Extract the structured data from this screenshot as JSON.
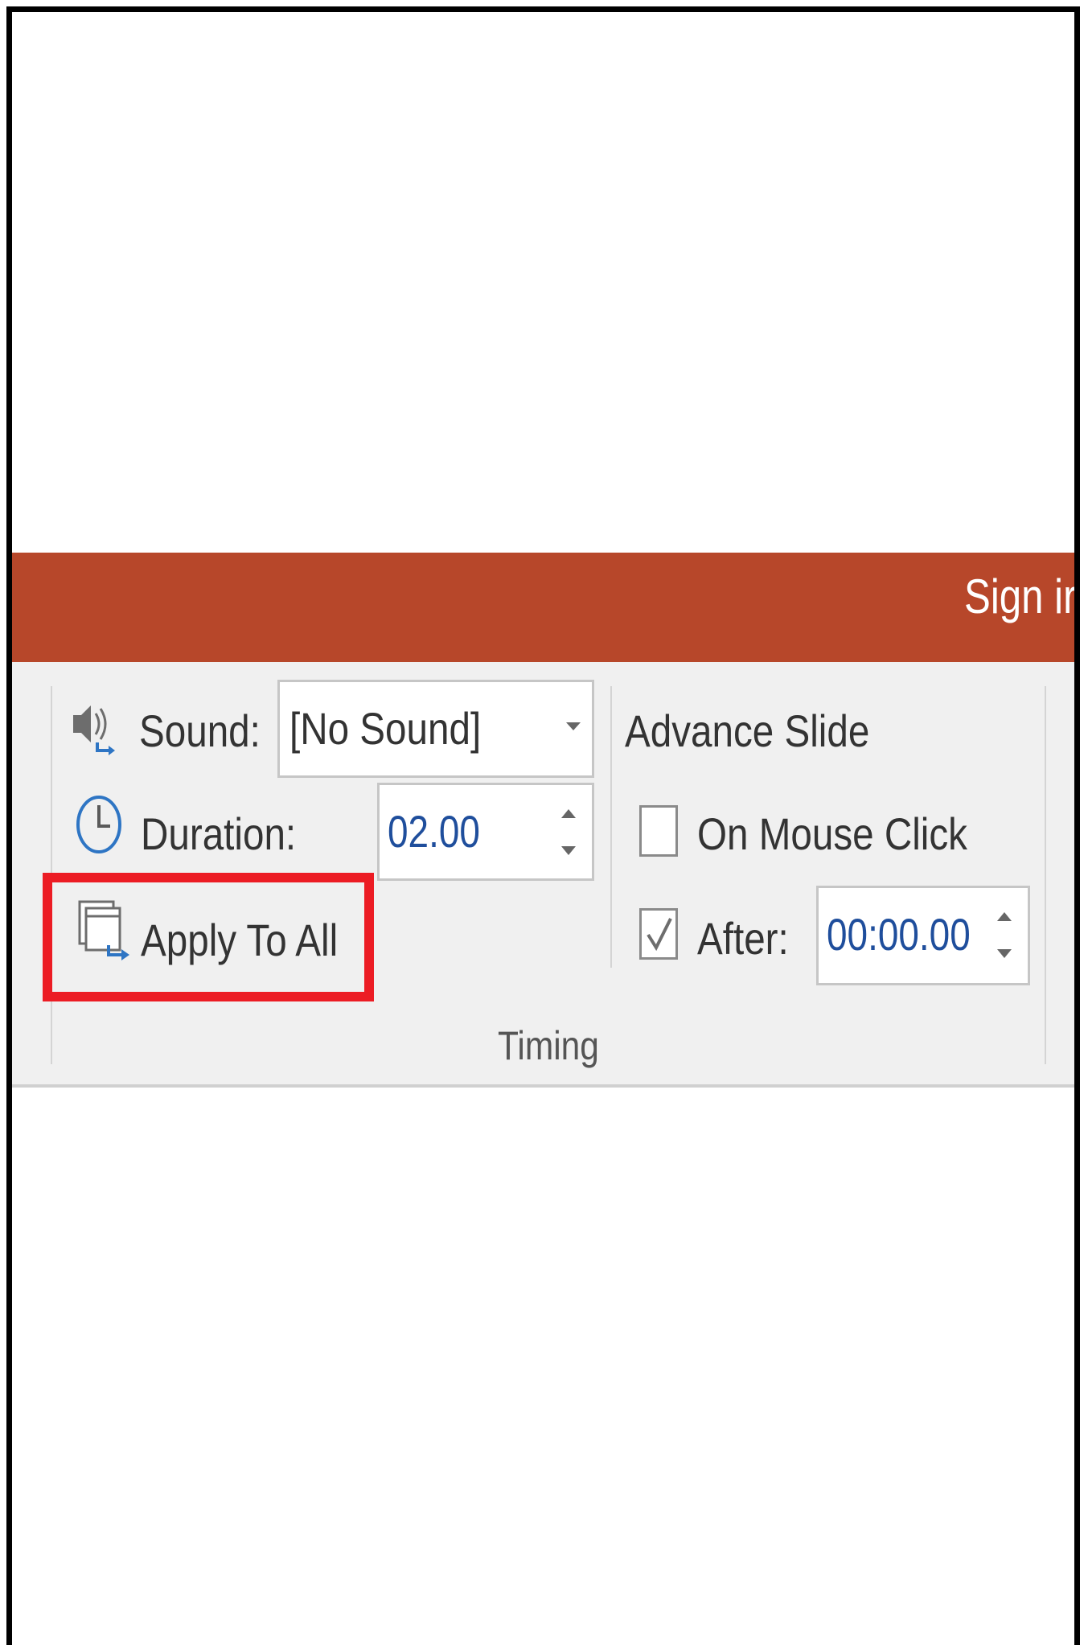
{
  "titlebar": {
    "sign_in_label": "Sign ir",
    "color": "#b7472a"
  },
  "ribbon": {
    "sound": {
      "icon": "speaker-icon",
      "label": "Sound:",
      "value": "[No Sound]"
    },
    "duration": {
      "icon": "clock-icon",
      "label": "Duration:",
      "value": "02.00"
    },
    "apply_to_all": {
      "icon": "apply-to-all-icon",
      "label": "Apply To All",
      "highlight_color": "#ec1c24"
    },
    "advance_slide": {
      "heading": "Advance Slide",
      "on_mouse_click": {
        "label": "On Mouse Click",
        "checked": false
      },
      "after": {
        "label": "After:",
        "checked": true,
        "value": "00:00.00"
      }
    },
    "group_label": "Timing"
  }
}
